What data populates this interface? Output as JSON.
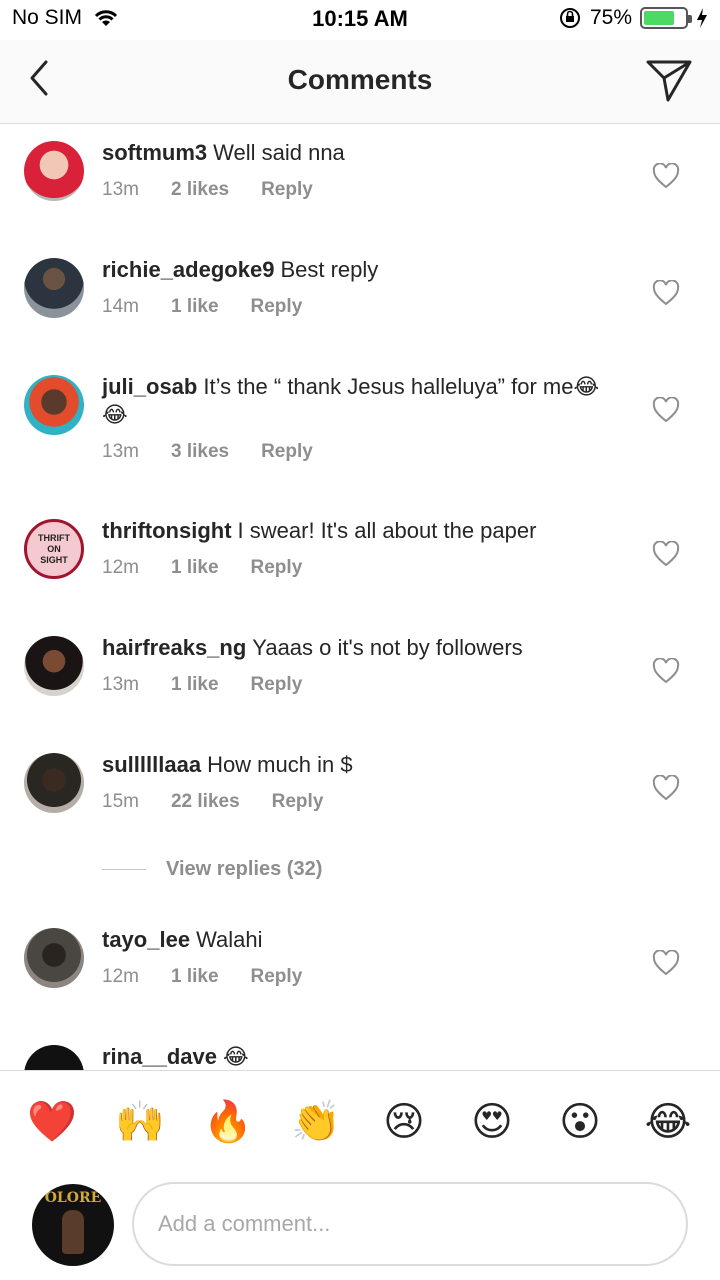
{
  "status_bar": {
    "carrier": "No SIM",
    "time": "10:15 AM",
    "battery_pct": "75%",
    "battery_level": 0.75
  },
  "header": {
    "title": "Comments",
    "back_icon": "chevron-left-icon",
    "send_icon": "paper-plane-icon"
  },
  "comments": [
    {
      "username": "softmum3",
      "text": "Well said nna",
      "time": "13m",
      "likes": "2 likes",
      "reply": "Reply",
      "avatar_color": "#c43a5c"
    },
    {
      "username": "richie_adegoke9",
      "text": "Best reply",
      "time": "14m",
      "likes": "1 like",
      "reply": "Reply",
      "avatar_color": "#3a4654"
    },
    {
      "username": "juli_osab",
      "text": "It’s the “ thank Jesus halleluya” for me😂 😂",
      "time": "13m",
      "likes": "3 likes",
      "reply": "Reply",
      "avatar_color": "#2aa7b8"
    },
    {
      "username": "thriftonsight",
      "text": "I swear! It's all about the paper",
      "time": "12m",
      "likes": "1 like",
      "reply": "Reply",
      "avatar_color": "#f2c4cc",
      "avatar_text": "THRIFT ON SIGHT"
    },
    {
      "username": "hairfreaks_ng",
      "text": "Yaaas o it's not by followers",
      "time": "13m",
      "likes": "1 like",
      "reply": "Reply",
      "avatar_color": "#2b2020"
    },
    {
      "username": "sullllllaaa",
      "text": "How much in $",
      "time": "15m",
      "likes": "22 likes",
      "reply": "Reply",
      "avatar_color": "#3b3530"
    },
    {
      "username": "tayo_lee",
      "text": "Walahi",
      "time": "12m",
      "likes": "1 like",
      "reply": "Reply",
      "avatar_color": "#4a4642"
    },
    {
      "username": "rina__dave",
      "text": "😂",
      "avatar_color": "#111111"
    }
  ],
  "view_replies": "View replies (32)",
  "emoji_bar": [
    "❤️",
    "🙌",
    "🔥",
    "👏",
    "😢",
    "😍",
    "😮",
    "😂"
  ],
  "composer": {
    "placeholder": "Add a comment...",
    "avatar_text": "OLORE"
  }
}
